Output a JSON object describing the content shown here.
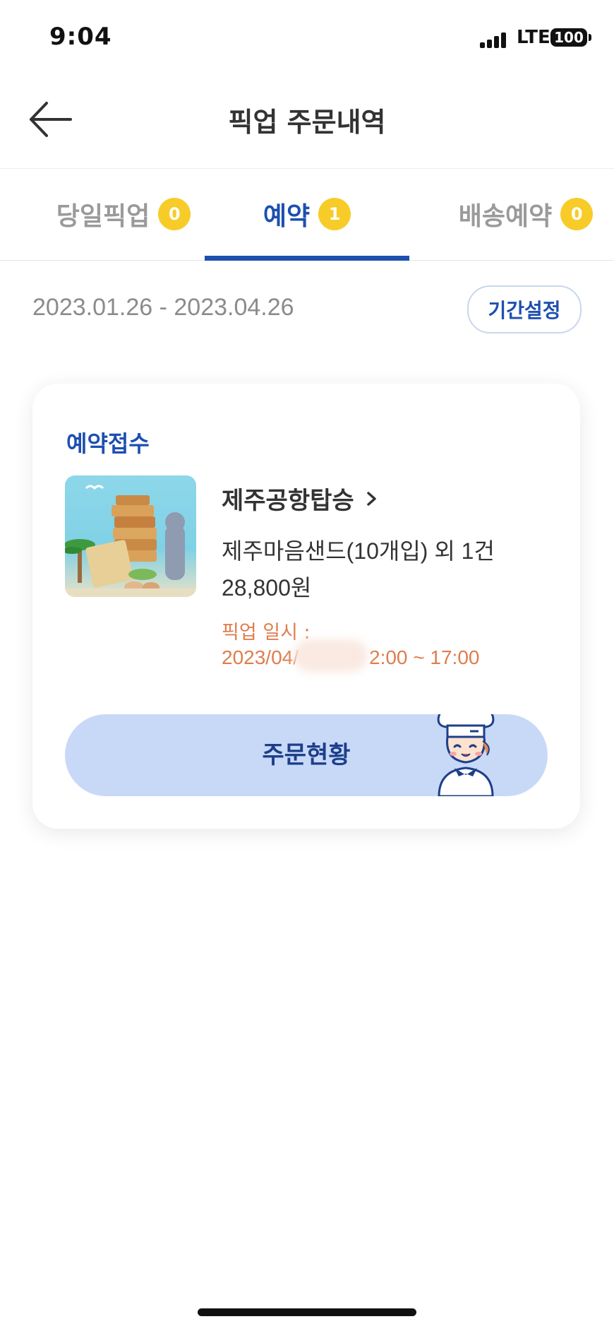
{
  "status_bar": {
    "time": "9:04",
    "network": "LTE",
    "battery": "100"
  },
  "header": {
    "title": "픽업 주문내역",
    "back_icon": "arrow-left-icon"
  },
  "tabs": [
    {
      "label": "당일픽업",
      "count": "0",
      "active": false
    },
    {
      "label": "예약",
      "count": "1",
      "active": true
    },
    {
      "label": "배송예약",
      "count": "0",
      "active": false
    }
  ],
  "filter": {
    "date_range": "2023.01.26 - 2023.04.26",
    "period_button": "기간설정"
  },
  "order": {
    "status": "예약접수",
    "store": "제주공항탑승",
    "product_summary": "제주마음샌드(10개입) 외 1건",
    "price": "28,800원",
    "pickup_label": "픽업 일시 :",
    "pickup_time_start": "2023/04/",
    "pickup_time_end": "2:00 ~ 17:00",
    "action_button": "주문현황",
    "image_icon": "product-photo-sand-cookies",
    "mascot_icon": "chef-mascot-icon"
  },
  "colors": {
    "brand_blue": "#1d4fb0",
    "badge_yellow": "#f7cc28",
    "pickup_orange": "#df7d4e",
    "button_light_blue": "#c8d9f8"
  }
}
